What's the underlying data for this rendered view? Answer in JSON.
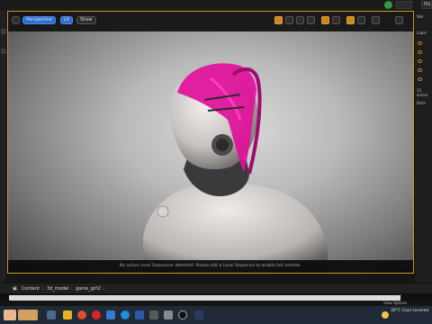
{
  "topbar": {
    "btn1": "",
    "btn2": "Ma"
  },
  "viewport": {
    "perspective_label": "Perspective",
    "lit_label": "Lit",
    "show_label": "Show",
    "notice": "No active Level Sequencer detected. Please edit a Level Sequence to enable full controls."
  },
  "right_panel": {
    "tab_world": "Wor",
    "tab_label": "Label",
    "count": "15 actors",
    "details": "Deta"
  },
  "breadcrumb": {
    "content": "Content",
    "folder1": "3d_model",
    "folder2": "game_girl2"
  },
  "search": {
    "view_options": "View Options"
  },
  "taskbar": {
    "temp": "30°C",
    "weather": "Cool covered"
  },
  "colors": {
    "accent_orange": "#c9871c",
    "hair_magenta": "#e0109a",
    "viewport_border": "#c89a1a"
  }
}
